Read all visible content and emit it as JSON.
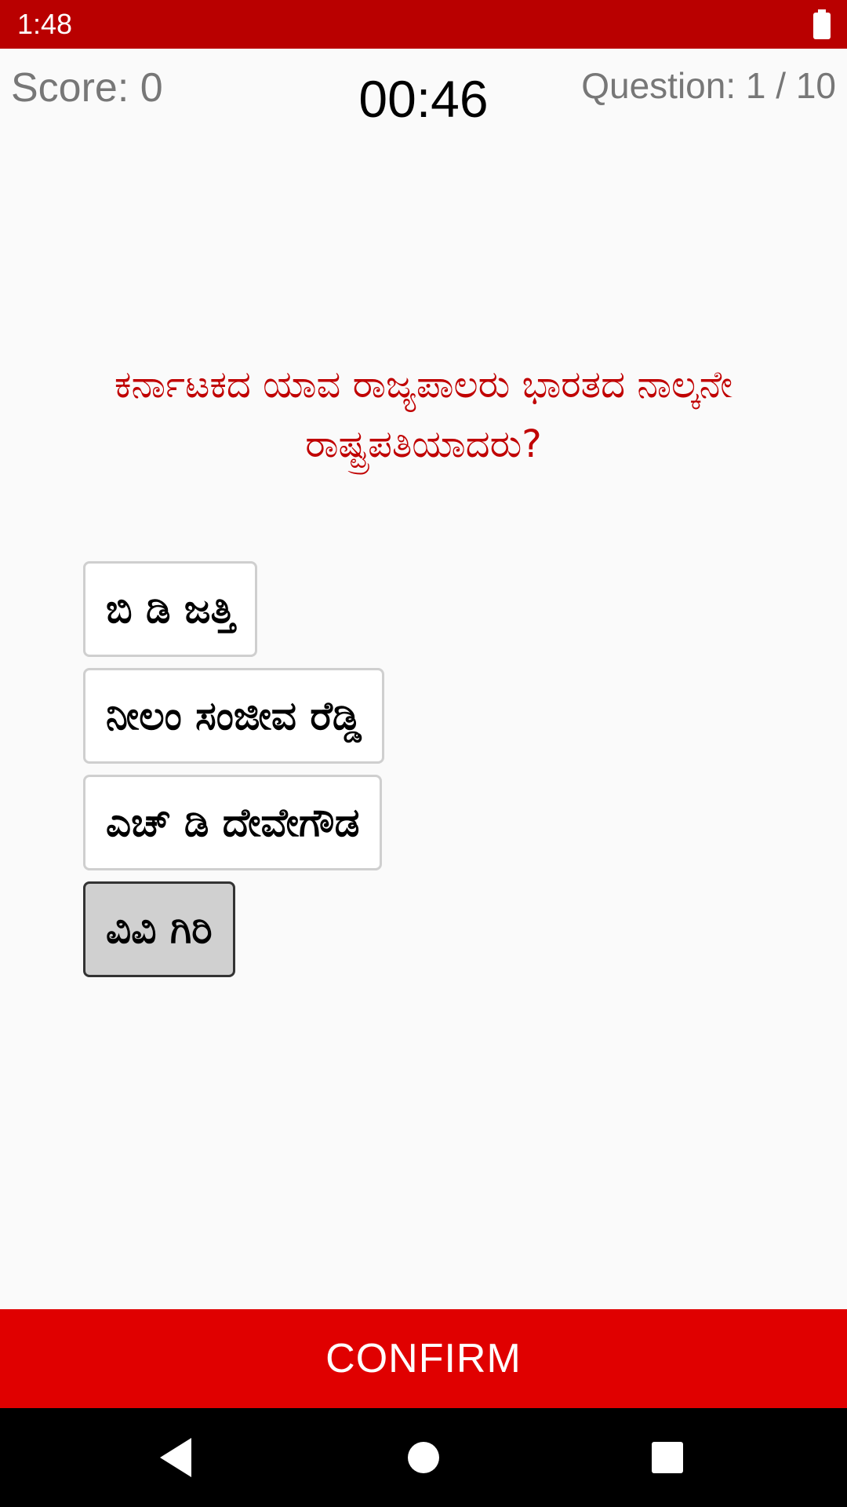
{
  "status_bar": {
    "time": "1:48",
    "battery_icon": "battery-full-icon"
  },
  "header": {
    "score": "Score: 0",
    "timer": "00:46",
    "question_counter": "Question: 1 / 10"
  },
  "question": {
    "text": "ಕರ್ನಾಟಕದ ಯಾವ ರಾಜ್ಯಪಾಲರು ಭಾರತದ ನಾಲ್ಕನೇ ರಾಷ್ಟ್ರಪತಿಯಾದರು?"
  },
  "options": [
    {
      "label": "ಬಿ ಡಿ ಜತ್ತಿ",
      "selected": false
    },
    {
      "label": "ನೀಲಂ  ಸಂಜೀವ  ರೆಡ್ಡಿ",
      "selected": false
    },
    {
      "label": "ಎಚ್ ಡಿ ದೇವೇಗೌಡ",
      "selected": false
    },
    {
      "label": "ವಿವಿ ಗಿರಿ",
      "selected": true
    }
  ],
  "confirm_button": {
    "label": "CONFIRM"
  },
  "nav_bar": {
    "back_icon": "back-triangle-icon",
    "home_icon": "home-circle-icon",
    "recent_icon": "recent-apps-square-icon"
  },
  "colors": {
    "status_bar": "#b90000",
    "question_text": "#c00000",
    "confirm_button": "#e00000",
    "selected_option": "#d0d0d0"
  }
}
